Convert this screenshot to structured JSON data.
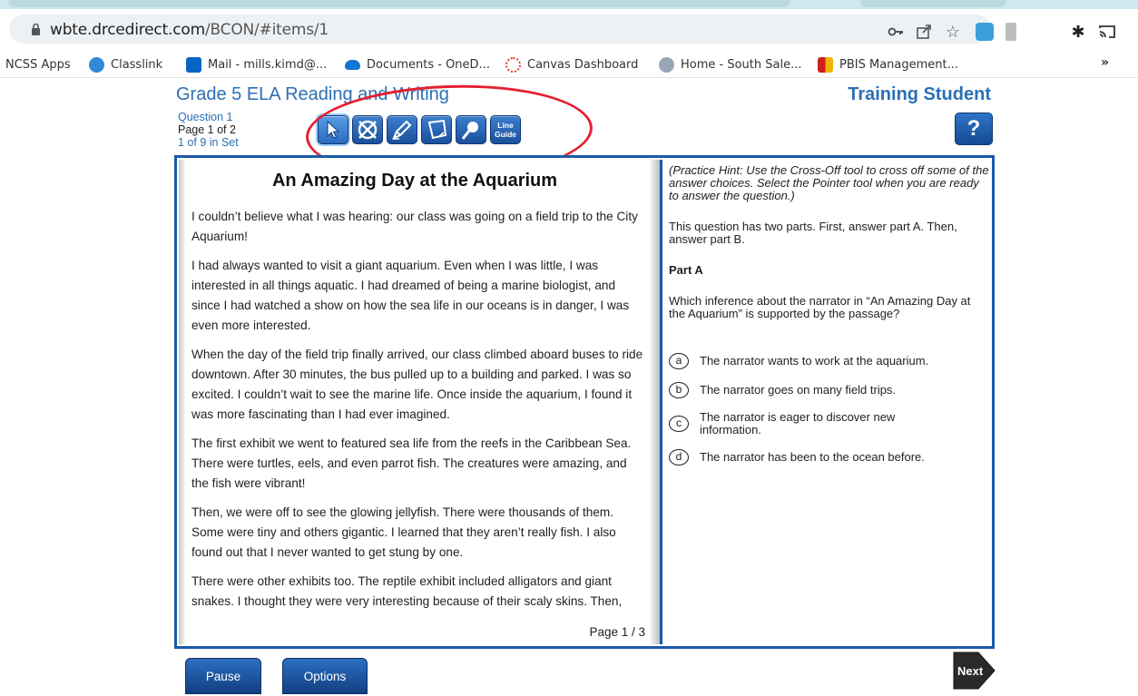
{
  "browser": {
    "url_domain": "wbte.drcedirect.com",
    "url_path": "/BCON/#items/1"
  },
  "bookmarks": [
    {
      "label": "NCSS Apps"
    },
    {
      "label": "Classlink"
    },
    {
      "label": "Mail - mills.kimd@..."
    },
    {
      "label": "Documents - OneD..."
    },
    {
      "label": "Canvas Dashboard"
    },
    {
      "label": "Home - South Sale..."
    },
    {
      "label": "PBIS Management..."
    }
  ],
  "bookmarks_more": "»",
  "header": {
    "title": "Grade 5 ELA Reading and Writing",
    "student": "Training Student",
    "question": "Question 1",
    "page": "Page 1 of 2",
    "set": "1 of 9 in Set",
    "help": "?"
  },
  "toolbar": {
    "line_guide_line1": "Line",
    "line_guide_line2": "Guide"
  },
  "passage": {
    "title": "An Amazing Day at the Aquarium",
    "paragraphs": [
      "I couldn’t believe what I was hearing: our class was going on a field trip to the City Aquarium!",
      "I had always wanted to visit a giant aquarium. Even when I was little, I was interested in all things aquatic. I had dreamed of being a marine biologist, and since I had watched a show on how the sea life in our oceans is in danger, I was even more interested.",
      "When the day of the field trip finally arrived, our class climbed aboard buses to ride downtown. After 30 minutes, the bus pulled up to a building and parked. I was so excited. I couldn’t wait to see the marine life. Once inside the aquarium, I found it was more fascinating than I had ever imagined.",
      "The first exhibit we went to featured sea life from the reefs in the Caribbean Sea. There were turtles, eels, and even parrot fish. The creatures were amazing, and the fish were vibrant!",
      "Then, we were off to see the glowing jellyfish. There were thousands of them. Some were tiny and others gigantic. I learned that they aren’t really fish. I also found out that I never wanted to get stung by one.",
      "There were other exhibits too. The reptile exhibit included alligators and giant snakes. I thought they were very interesting because of their scaly skins. Then,"
    ],
    "page": "Page 1 / 3"
  },
  "question": {
    "hint": "(Practice Hint: Use the Cross-Off tool to cross off some of the answer choices. Select the Pointer tool when you are ready to answer the question.)",
    "intro": "This question has two parts. First, answer part A. Then, answer part B.",
    "part": "Part A",
    "stem": "Which inference about the narrator in “An Amazing Day at the Aquarium” is supported by the passage?",
    "choices": [
      {
        "letter": "a",
        "text": "The narrator wants to work at the aquarium."
      },
      {
        "letter": "b",
        "text": "The narrator goes on many field trips."
      },
      {
        "letter": "c",
        "text": "The narrator is eager to discover new information."
      },
      {
        "letter": "d",
        "text": "The narrator has been to the ocean before."
      }
    ]
  },
  "footer": {
    "pause": "Pause",
    "options": "Options",
    "next": "Next"
  },
  "colors": {
    "accent_blue": "#2c6fb4",
    "frame_blue": "#1c5aa8",
    "annotation_red": "#e52030"
  }
}
